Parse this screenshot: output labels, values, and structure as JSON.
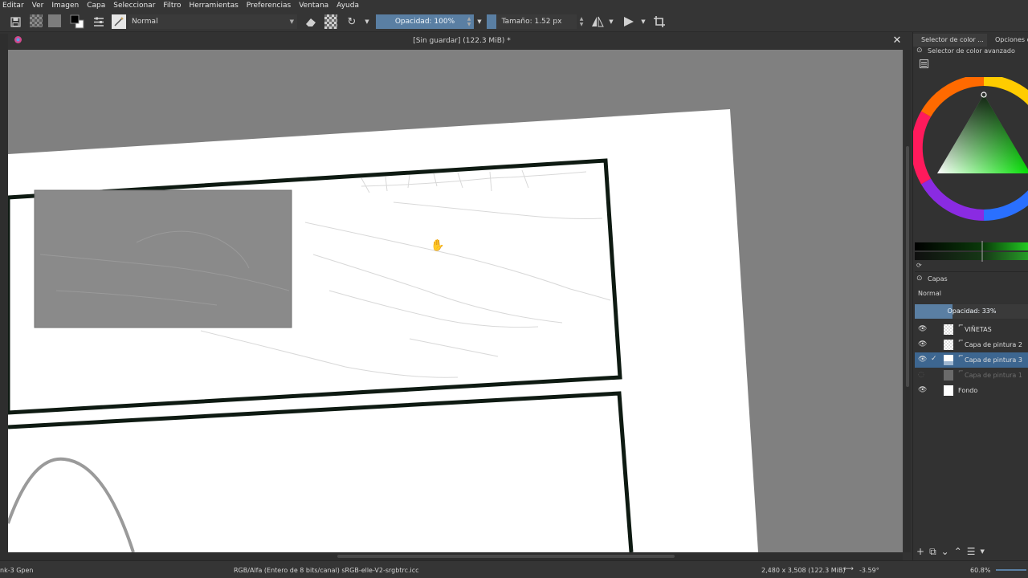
{
  "menu": [
    "Editar",
    "Ver",
    "Imagen",
    "Capa",
    "Seleccionar",
    "Filtro",
    "Herramientas",
    "Preferencias",
    "Ventana",
    "Ayuda"
  ],
  "toolbar": {
    "blend_mode": "Normal",
    "opacity_label": "Opacidad: 100%",
    "size_label": "Tamaño: 1.52 px",
    "opacity_value": 1.0
  },
  "document": {
    "title": "[Sin guardar]  (122.3 MiB) *"
  },
  "docker": {
    "tab_color_selector": "Selector de color ...",
    "tab_tool_options": "Opciones de",
    "advanced_selector_title": "Selector de color avanzado",
    "layers_title": "Capas",
    "layers_blend_mode": "Normal",
    "layers_opacity_label": "Opacidad:  33%",
    "layers_opacity_value": 0.33,
    "layers": [
      {
        "name": "VIÑETAS",
        "visible": true,
        "active": false
      },
      {
        "name": "Capa de pintura 2",
        "visible": true,
        "active": false
      },
      {
        "name": "Capa de pintura 3",
        "visible": true,
        "active": true
      },
      {
        "name": "Capa de pintura 1",
        "visible": false,
        "active": false
      },
      {
        "name": "Fondo",
        "visible": true,
        "active": false
      }
    ]
  },
  "status": {
    "brush": "nk-3 Gpen",
    "color_info": "RGB/Alfa (Entero de 8 bits/canal)  sRGB-elle-V2-srgbtrc.icc",
    "image_size": "2,480 x 3,508 (122.3 MiB)",
    "rotation": "-3.59°",
    "zoom": "60.8%"
  },
  "colors": {
    "accent": "#5a7fa3",
    "active_layer": "#3d6690",
    "canvas_bg": "#808080",
    "panel_bg": "#323232"
  }
}
